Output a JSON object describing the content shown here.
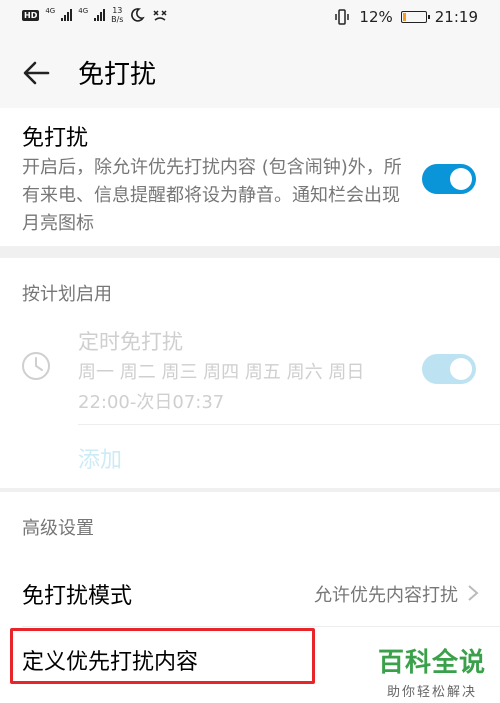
{
  "status_bar": {
    "hd": "HD",
    "net1": "4G",
    "net2": "4G",
    "speed_value": "13",
    "speed_unit": "B/s",
    "battery_text": "12%",
    "battery_level": 0.12,
    "battery_color": "#f29c24",
    "time": "21:19",
    "icons": [
      "moon-icon",
      "notification-muted-icon",
      "vibrate-icon"
    ]
  },
  "header": {
    "title": "免打扰"
  },
  "dnd": {
    "label": "免打扰",
    "description": "开启后，除允许优先打扰内容 (包含闹钟)外，所有来电、信息提醒都将设为静音。通知栏会出现月亮图标",
    "enabled": true
  },
  "schedule": {
    "header": "按计划启用",
    "timer": {
      "title": "定时免打扰",
      "days": "周一 周二 周三 周四 周五 周六 周日",
      "time": "22:00-次日07:37",
      "enabled": true
    },
    "add_label": "添加"
  },
  "advanced": {
    "header": "高级设置",
    "mode_label": "免打扰模式",
    "mode_value": "允许优先内容打扰",
    "priority_label": "定义优先打扰内容"
  },
  "watermark": {
    "title": "百科全说",
    "subtitle": "助你轻松解决"
  },
  "colors": {
    "accent": "#0a95d8",
    "highlight_box": "#e8262a",
    "watermark": "#3aa14a"
  }
}
